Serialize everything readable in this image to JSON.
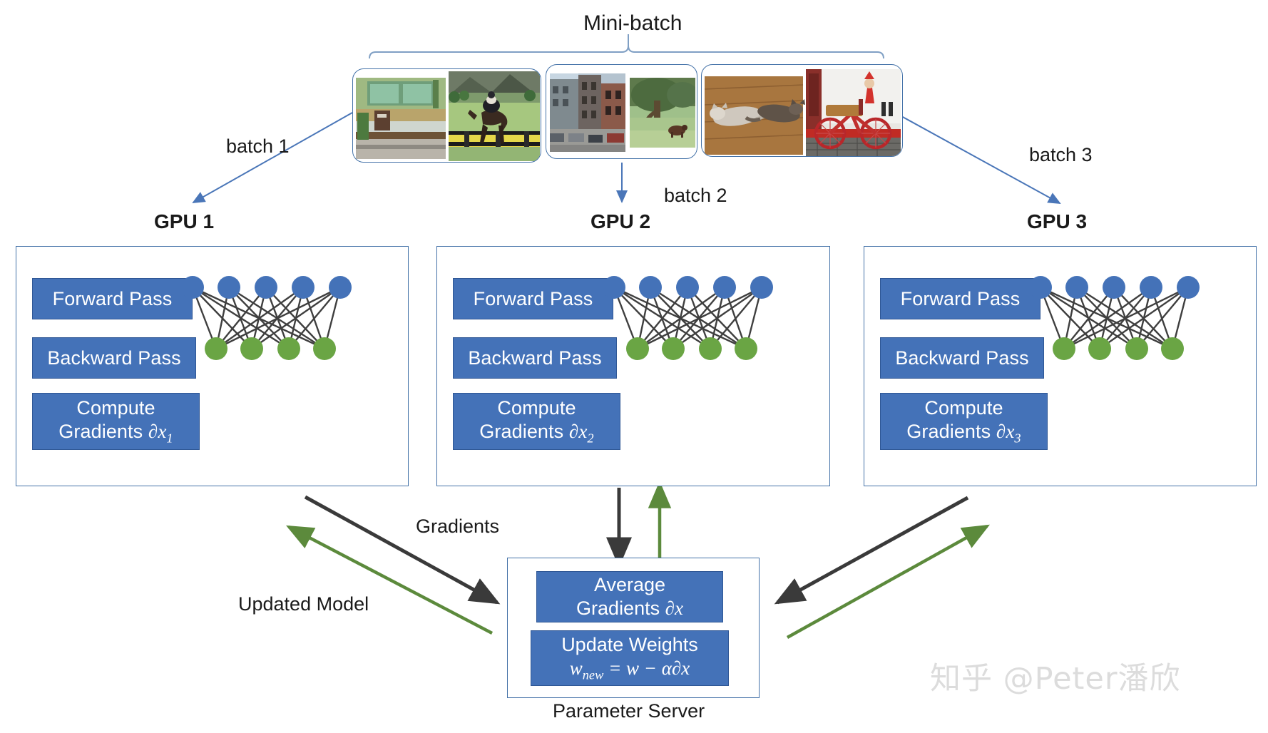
{
  "diagram": {
    "title": "Mini-batch",
    "type": "data-parallel-training-diagram"
  },
  "labels": {
    "mini_batch": "Mini-batch",
    "batch1": "batch 1",
    "batch2": "batch 2",
    "batch3": "batch 3",
    "gradients": "Gradients",
    "updated_model": "Updated Model",
    "parameter_server": "Parameter Server"
  },
  "gpus": [
    {
      "name": "GPU 1",
      "forward": "Forward Pass",
      "backward": "Backward Pass",
      "compute_line1": "Compute",
      "compute_line2": "Gradients",
      "compute_symbol": "∂x",
      "compute_subscript": "1",
      "network": {
        "input_nodes": 5,
        "output_nodes": 4,
        "input_color": "#4472b8",
        "output_color": "#6aa544"
      }
    },
    {
      "name": "GPU 2",
      "forward": "Forward Pass",
      "backward": "Backward Pass",
      "compute_line1": "Compute",
      "compute_line2": "Gradients",
      "compute_symbol": "∂x",
      "compute_subscript": "2",
      "network": {
        "input_nodes": 5,
        "output_nodes": 4,
        "input_color": "#4472b8",
        "output_color": "#6aa544"
      }
    },
    {
      "name": "GPU 3",
      "forward": "Forward Pass",
      "backward": "Backward Pass",
      "compute_line1": "Compute",
      "compute_line2": "Gradients",
      "compute_symbol": "∂x",
      "compute_subscript": "3",
      "network": {
        "input_nodes": 5,
        "output_nodes": 4,
        "input_color": "#4472b8",
        "output_color": "#6aa544"
      }
    }
  ],
  "batches": [
    {
      "id": "batch-1",
      "images": [
        "green-glass-house-photo",
        "horse-jumping-photo"
      ]
    },
    {
      "id": "batch-2",
      "images": [
        "city-street-photo",
        "cow-under-tree-photo"
      ]
    },
    {
      "id": "batch-3",
      "images": [
        "cats-on-floor-photo",
        "red-bicycle-photo"
      ]
    }
  ],
  "parameter_server": {
    "title": "Parameter Server",
    "average_line1": "Average",
    "average_line2": "Gradients",
    "average_symbol": "∂x",
    "update_line1": "Update Weights",
    "update_formula_w": "w",
    "update_formula_sub": "new",
    "update_formula_rest": "= w − α∂x"
  },
  "flows": {
    "gradients_label": "Gradients",
    "gradients_color": "#3a3a3a",
    "updated_model_label": "Updated Model",
    "updated_model_color": "#5c8a3c",
    "batch_arrow_color": "#4a76b8"
  },
  "colors": {
    "box_blue": "#4472b8",
    "border_blue": "#4472a8",
    "node_blue": "#4472b8",
    "node_green": "#6aa544",
    "edge_gray": "#3f3f3f",
    "text_dark": "#1a1a1a",
    "watermark": "#dcdcdc"
  },
  "watermark": {
    "text": "知乎 @Peter潘欣"
  }
}
